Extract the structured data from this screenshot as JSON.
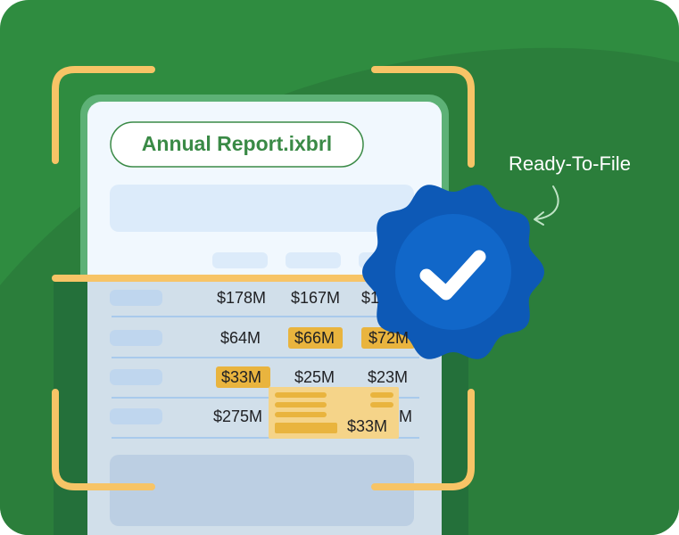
{
  "document": {
    "file_name": "Annual Report.ixbrl"
  },
  "callout": {
    "label": "Ready-To-File"
  },
  "table": {
    "rows": [
      [
        "$178M",
        "$167M",
        "$1"
      ],
      [
        "$64M",
        "$66M",
        "$72M"
      ],
      [
        "$33M",
        "$25M",
        "$23M"
      ],
      [
        "$275M",
        "",
        "M"
      ]
    ]
  },
  "tooltip": {
    "value": "$33M"
  },
  "icons": {
    "badge": "verified-check-badge-icon",
    "arrow": "curved-arrow-icon",
    "scanner": "scan-frame-corners"
  },
  "colors": {
    "background": "#2F8C40",
    "highlight": "#E9B43E",
    "scan_line": "#F7C466",
    "badge": "#0D59B6",
    "title_text": "#3A8A46"
  }
}
